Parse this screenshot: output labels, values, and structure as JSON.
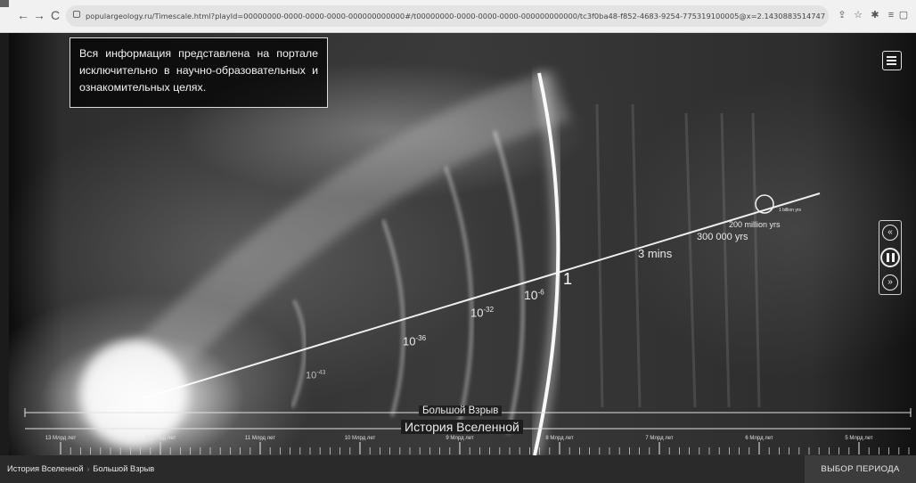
{
  "browser": {
    "back_glyph": "←",
    "forward_glyph": "→",
    "reload_glyph": "C",
    "url": "populargeology.ru/Timescale.html?playId=00000000-0000-0000-0000-000000000000#/t00000000-0000-0000-0000-000000000000/tc3f0ba48-f852-4683-9254-775319100005@x=2.1430883514747192e-15&y=1&w=1.02163331530558&h=5…",
    "toolbar_icons": [
      "share-icon",
      "star-icon",
      "extensions-icon",
      "reading-list-icon",
      "sidebar-icon",
      "profile-icon",
      "more-icon"
    ]
  },
  "notice": {
    "text": "Вся информация представлена на портале исключительно в научно-образовательных и ознакомительных целях."
  },
  "scene_labels": {
    "t1": "10",
    "t1_exp": "-43",
    "t2": "10",
    "t2_exp": "-36",
    "t3": "10",
    "t3_exp": "-32",
    "t4": "10",
    "t4_exp": "-6",
    "t5": "1",
    "t6": "3 mins",
    "t7": "300 000 yrs",
    "t8": "200 million yrs",
    "t9": "1 billion yrs"
  },
  "timeline": {
    "big_bang_label": "Большой Взрыв",
    "history_label": "История Вселенной",
    "ticks": [
      "13 Млрд лет",
      "12 Млрд лет",
      "11 Млрд лет",
      "10 Млрд лет",
      "9 Млрд лет",
      "8 Млрд лет",
      "7 Млрд лет",
      "6 Млрд лет",
      "5 Млрд лет"
    ]
  },
  "bottom": {
    "breadcrumb_root": "История Вселенной",
    "breadcrumb_sep": "›",
    "breadcrumb_current": "Большой Взрыв",
    "period_button": "ВЫБОР ПЕРИОДА"
  },
  "player": {
    "rewind_glyph": "«",
    "forward_glyph": "»"
  }
}
